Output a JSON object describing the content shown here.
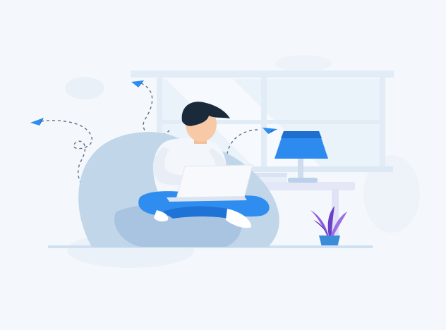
{
  "illustration": {
    "subject": "person-working-on-laptop-in-bean-bag",
    "icons": [
      "paper-plane-icon",
      "paper-plane-icon",
      "paper-plane-icon"
    ],
    "colors": {
      "background": "#f4f8fc",
      "accent_blue": "#2f8df0",
      "light_blue": "#cfe0f2",
      "beanbag": "#c2d6ea",
      "desk": "#e3e7f7",
      "lamp": "#2d8bef",
      "plant": "#7b4fd6",
      "hair": "#1a2a3a",
      "skin": "#f7c9a6"
    }
  }
}
